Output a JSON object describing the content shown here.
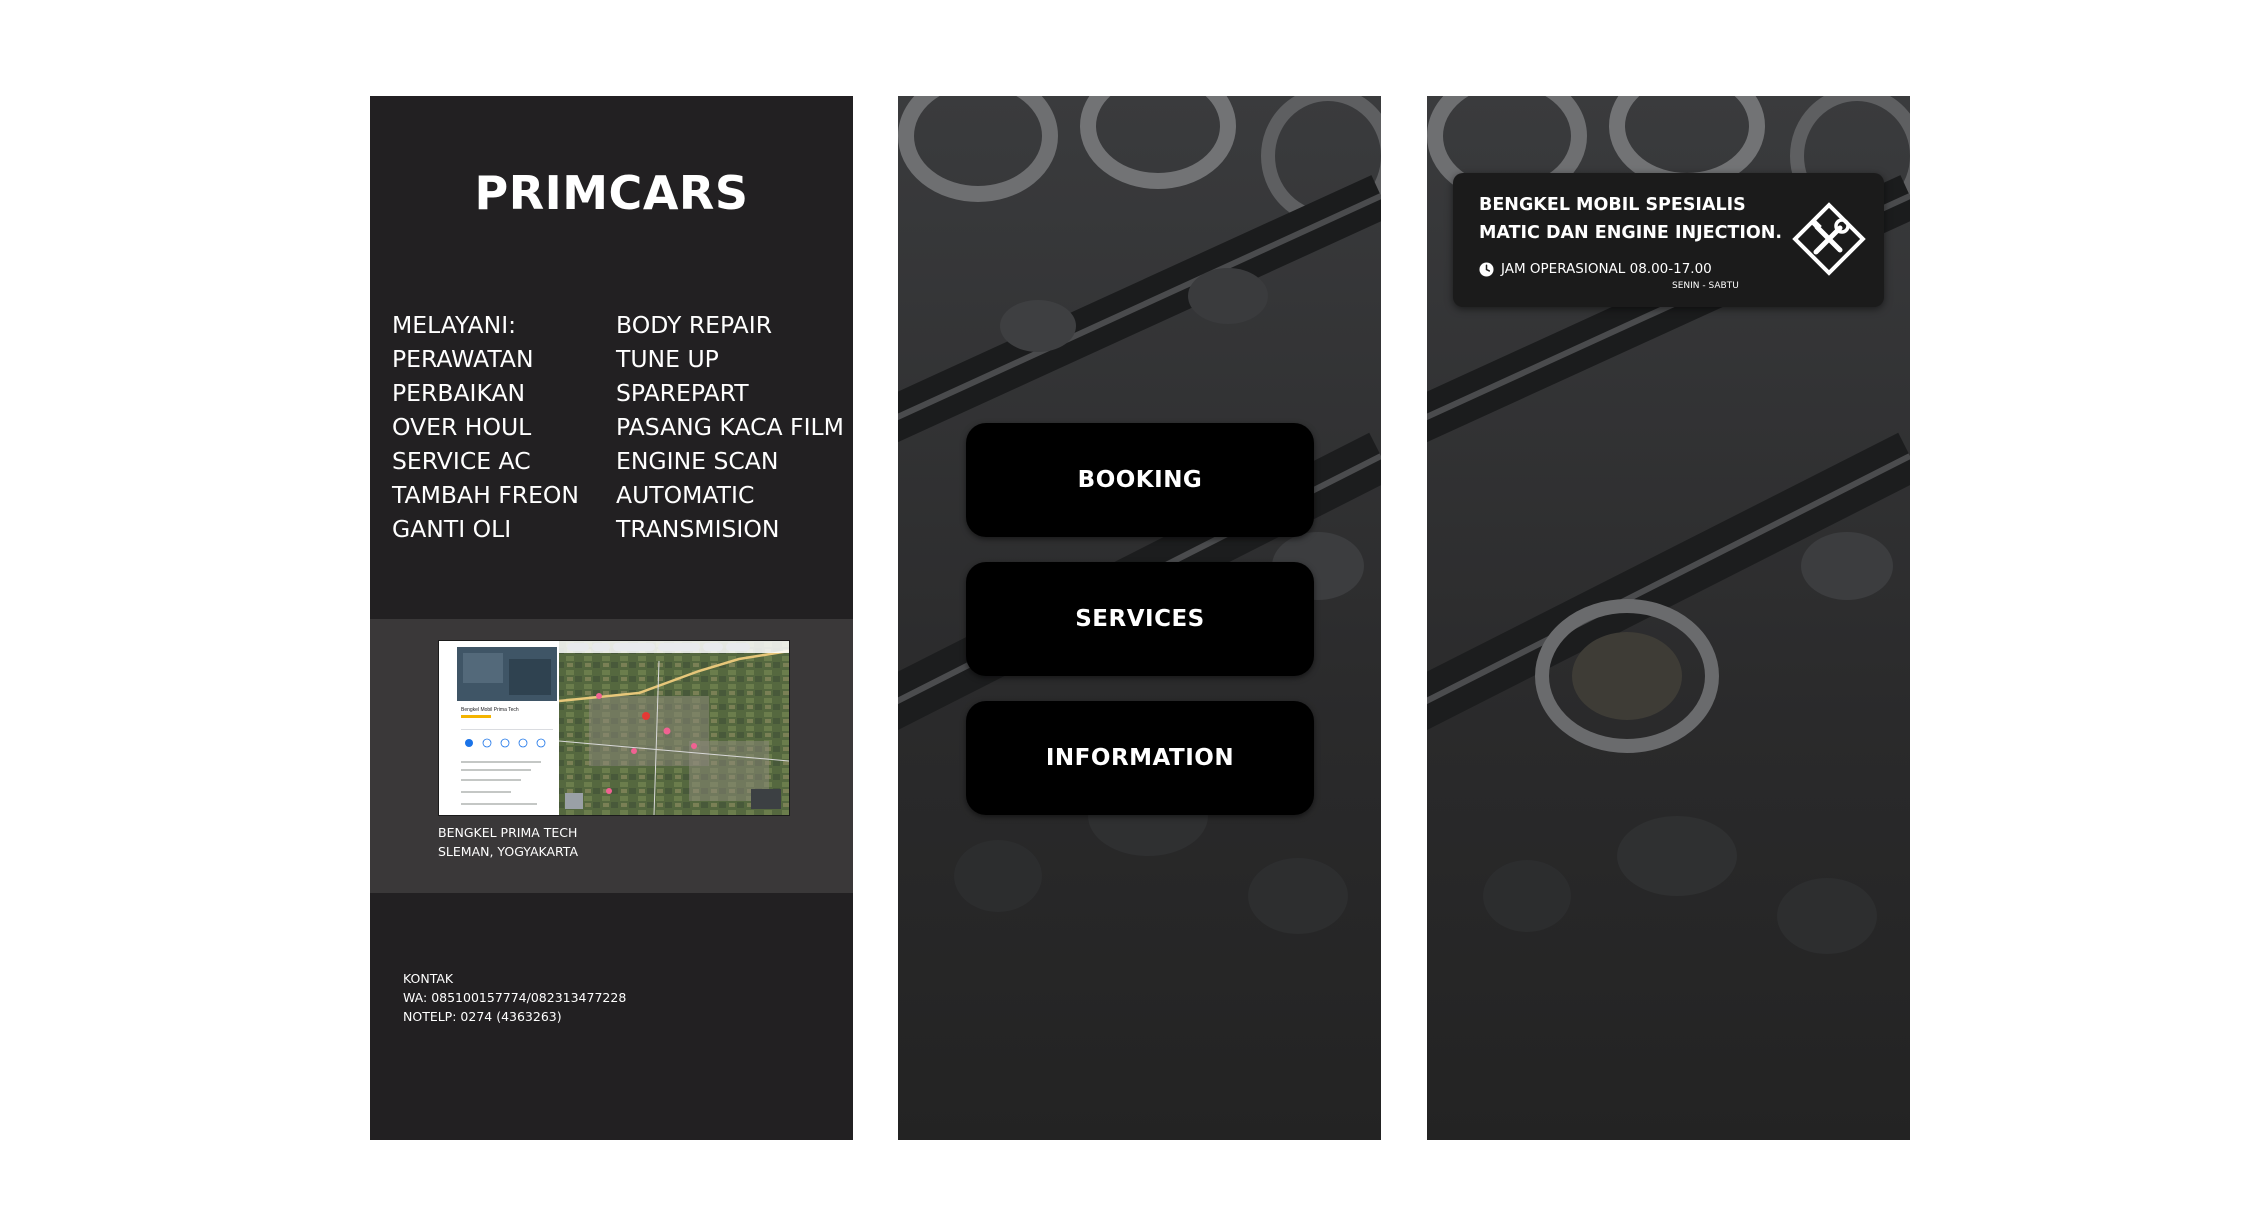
{
  "panel_info": {
    "brand": "PRIMCARS",
    "services_left": [
      "MELAYANI:",
      "PERAWATAN",
      "PERBAIKAN",
      "OVER HOUL",
      "SERVICE AC",
      "TAMBAH FREON",
      "GANTI OLI"
    ],
    "services_right": [
      "BODY REPAIR",
      "TUNE UP",
      "SPAREPART",
      "PASANG KACA FILM",
      "ENGINE SCAN",
      "AUTOMATIC",
      "TRANSMISION"
    ],
    "map": {
      "caption_line1": "BENGKEL PRIMA TECH",
      "caption_line2": "SLEMAN, YOGYAKARTA",
      "listing_name": "Bengkel Mobil Prima Tech"
    },
    "contact": {
      "label": "KONTAK",
      "wa": "WA: 085100157774/082313477228",
      "phone": "NOTELP: 0274 (4363263)"
    }
  },
  "panel_menu": {
    "buttons": [
      "BOOKING",
      "SERVICES",
      "INFORMATION"
    ]
  },
  "panel_about": {
    "title_line1": "BENGKEL MOBIL SPESIALIS",
    "title_line2": "MATIC DAN ENGINE INJECTION.",
    "hours": "JAM OPERASIONAL 08.00-17.00",
    "days": "SENIN - SABTU",
    "icons": [
      "clock-icon",
      "tools-icon"
    ]
  },
  "colors": {
    "panel_dark": "#222022",
    "map_band": "#3a3839",
    "button": "#000000",
    "card": "#1b1b1b",
    "text": "#ffffff"
  }
}
